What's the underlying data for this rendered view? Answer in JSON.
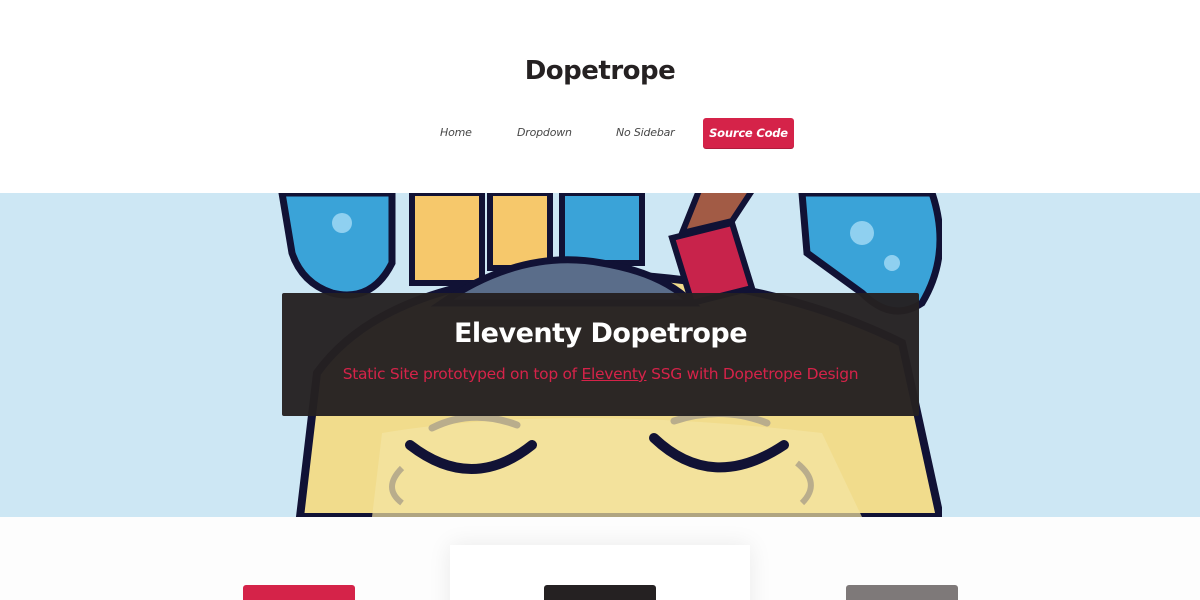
{
  "site": {
    "title": "Dopetrope"
  },
  "nav": {
    "items": [
      {
        "label": "Home"
      },
      {
        "label": "Dropdown"
      },
      {
        "label": "No Sidebar"
      },
      {
        "label": "Source Code"
      }
    ]
  },
  "banner": {
    "title": "Eleventy Dopetrope",
    "subtitle_before": "Static Site prototyped on top of",
    "subtitle_link": "Eleventy",
    "subtitle_after": "SSG with Dopetrope Design"
  },
  "colors": {
    "accent": "#d52349",
    "dark": "#252122",
    "banner_bg": "#cde7f4",
    "gray": "#7e7979"
  },
  "features": {
    "tiles": [
      {
        "color": "#d52349"
      },
      {
        "color": "#252122"
      },
      {
        "color": "#7e7979"
      }
    ]
  }
}
